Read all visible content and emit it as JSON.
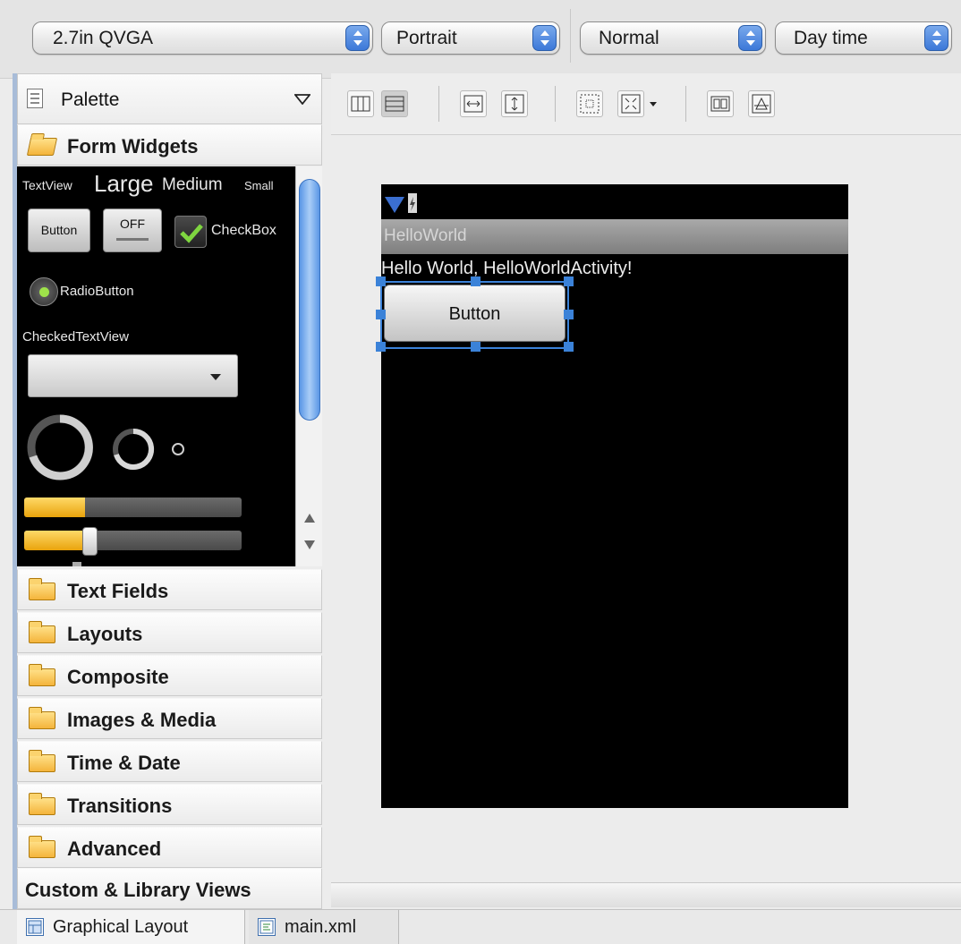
{
  "top_bar": {
    "device_config": "2.7in QVGA",
    "orientation": "Portrait",
    "dock_mode": "Normal",
    "night_mode": "Day time"
  },
  "palette": {
    "title": "Palette",
    "categories": [
      {
        "label": "Form Widgets",
        "expanded": true
      },
      {
        "label": "Text Fields"
      },
      {
        "label": "Layouts"
      },
      {
        "label": "Composite"
      },
      {
        "label": "Images & Media"
      },
      {
        "label": "Time & Date"
      },
      {
        "label": "Transitions"
      },
      {
        "label": "Advanced"
      }
    ],
    "custom_views": "Custom & Library Views"
  },
  "form_widgets": {
    "textview_small_label": "TextView",
    "large": "Large",
    "medium": "Medium",
    "small": "Small",
    "button": "Button",
    "toggle": "OFF",
    "checkbox": "CheckBox",
    "radio": "RadioButton",
    "checked_text": "CheckedTextView",
    "progress_fill": 0.28,
    "seek_fill": 0.3
  },
  "device": {
    "app_title": "HelloWorld",
    "hello_text": "Hello World, HelloWorldActivity!",
    "button_label": "Button"
  },
  "editor_tabs": [
    "Graphical Layout",
    "main.xml"
  ],
  "colors": {
    "accent": "#3b82d8",
    "folder": "#f4b43b",
    "progress": "#e9a30c"
  }
}
